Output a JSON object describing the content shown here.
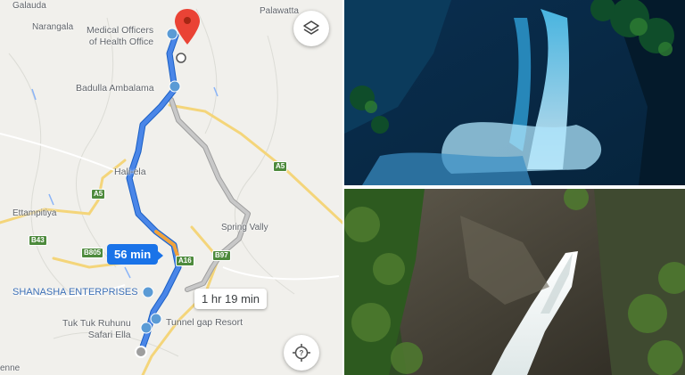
{
  "map": {
    "places": {
      "galauda": "Galauda",
      "palawatta": "Palawatta",
      "narangala": "Narangala",
      "medical_office": "Medical Officers\nof Health Office",
      "badulla_ambalama": "Badulla Ambalama",
      "hali_ela": "Hali-ela",
      "ettampitiya": "Ettampitiya",
      "spring_valley": "Spring Vally",
      "shanasha": "SHANASHA ENTERPRISES",
      "tuk_tuk": "Tuk Tuk Ruhunu\nSafari Ella",
      "tunnel_gap": "Tunnel gap Resort",
      "edge_left": "enne"
    },
    "roads": {
      "a5_top": "A5",
      "a5_left": "A5",
      "b43": "B43",
      "b805": "B805",
      "a16": "A16",
      "b97": "B97"
    },
    "route_primary_time": "56 min",
    "route_alt_time": "1 hr 19 min",
    "layers_icon": "layers-icon",
    "locate_icon": "locate-icon"
  },
  "colors": {
    "route_blue": "#4a86e8",
    "route_alt": "#b9b9b9",
    "pin_red": "#ea4335"
  }
}
